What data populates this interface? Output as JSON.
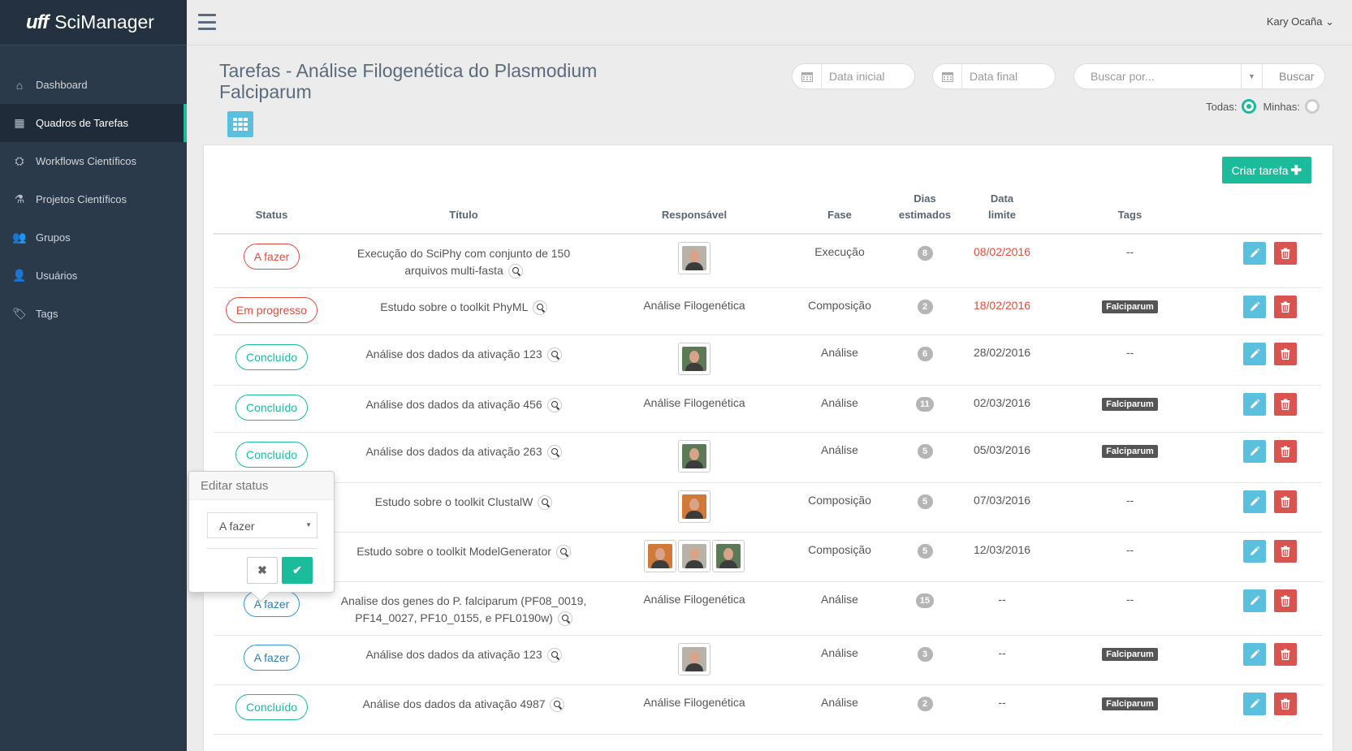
{
  "app": {
    "logo": "uff",
    "name": "SciManager"
  },
  "user": {
    "name": "Kary Ocaña ⌄"
  },
  "sidebar": {
    "items": [
      {
        "label": "Dashboard",
        "icon": "home-icon",
        "glyph": "⌂"
      },
      {
        "label": "Quadros de Tarefas",
        "icon": "grid-icon",
        "glyph": "▦"
      },
      {
        "label": "Workflows Científicos",
        "icon": "sitemap-icon",
        "glyph": "⛭"
      },
      {
        "label": "Projetos Científicos",
        "icon": "flask-icon",
        "glyph": "⚗"
      },
      {
        "label": "Grupos",
        "icon": "users-icon",
        "glyph": "👥"
      },
      {
        "label": "Usuários",
        "icon": "user-icon",
        "glyph": "👤"
      },
      {
        "label": "Tags",
        "icon": "tags-icon",
        "glyph": "🏷"
      }
    ],
    "active_index": 1
  },
  "header": {
    "title": "Tarefas - Análise Filogenética do Plasmodium Falciparum",
    "date_start_placeholder": "Data inicial",
    "date_end_placeholder": "Data final",
    "search_placeholder": "Buscar por...",
    "search_button": "Buscar",
    "filter_all": "Todas:",
    "filter_mine": "Minhas:"
  },
  "panel": {
    "create_button": "Criar tarefa"
  },
  "table": {
    "headers": {
      "status": "Status",
      "title": "Título",
      "responsible": "Responsável",
      "phase": "Fase",
      "days_1": "Dias",
      "days_2": "estimados",
      "deadline_1": "Data",
      "deadline_2": "limite",
      "tags": "Tags"
    },
    "rows": [
      {
        "status": "A fazer",
        "status_style": "afazer",
        "title": "Execução do SciPhy com conjunto de 150 arquivos multi-fasta",
        "resp_text": "",
        "avatars": [
          "f1"
        ],
        "phase": "Execução",
        "days": "8",
        "deadline": "08/02/2016",
        "deadline_overdue": true,
        "tag": "",
        "no_tag": "--"
      },
      {
        "status": "Em progresso",
        "status_style": "prog",
        "title": "Estudo sobre o toolkit PhyML",
        "resp_text": "Análise Filogenética",
        "avatars": [],
        "phase": "Composição",
        "days": "2",
        "deadline": "18/02/2016",
        "deadline_overdue": true,
        "tag": "Falciparum",
        "no_tag": ""
      },
      {
        "status": "Concluído",
        "status_style": "conc",
        "title": "Análise dos dados da ativação 123",
        "resp_text": "",
        "avatars": [
          "f2"
        ],
        "phase": "Análise",
        "days": "6",
        "deadline": "28/02/2016",
        "deadline_overdue": false,
        "tag": "",
        "no_tag": "--"
      },
      {
        "status": "Concluído",
        "status_style": "conc",
        "title": "Análise dos dados da ativação 456",
        "resp_text": "Análise Filogenética",
        "avatars": [],
        "phase": "Análise",
        "days": "11",
        "deadline": "02/03/2016",
        "deadline_overdue": false,
        "tag": "Falciparum",
        "no_tag": ""
      },
      {
        "status": "Concluído",
        "status_style": "conc",
        "title": "Análise dos dados da ativação 263",
        "resp_text": "",
        "avatars": [
          "f2"
        ],
        "phase": "Análise",
        "days": "5",
        "deadline": "05/03/2016",
        "deadline_overdue": false,
        "tag": "Falciparum",
        "no_tag": ""
      },
      {
        "status": "",
        "status_style": "hidden",
        "title": "Estudo sobre o toolkit ClustalW",
        "resp_text": "",
        "avatars": [
          "f3"
        ],
        "phase": "Composição",
        "days": "5",
        "deadline": "07/03/2016",
        "deadline_overdue": false,
        "tag": "",
        "no_tag": "--"
      },
      {
        "status": "",
        "status_style": "hidden",
        "title": "Estudo sobre o toolkit ModelGenerator",
        "resp_text": "",
        "avatars": [
          "f3",
          "f1",
          "f2"
        ],
        "phase": "Composição",
        "days": "5",
        "deadline": "12/03/2016",
        "deadline_overdue": false,
        "tag": "",
        "no_tag": "--"
      },
      {
        "status": "A fazer",
        "status_style": "afazer-blue",
        "title": "Analise dos genes do P. falciparum (PF08_0019, PF14_0027, PF10_0155, e PFL0190w)",
        "resp_text": "Análise Filogenética",
        "avatars": [],
        "phase": "Análise",
        "days": "15",
        "deadline": "--",
        "deadline_overdue": false,
        "tag": "",
        "no_tag": "--"
      },
      {
        "status": "A fazer",
        "status_style": "afazer-blue",
        "title": "Análise dos dados da ativação 123",
        "resp_text": "",
        "avatars": [
          "f1"
        ],
        "phase": "Análise",
        "days": "3",
        "deadline": "--",
        "deadline_overdue": false,
        "tag": "Falciparum",
        "no_tag": ""
      },
      {
        "status": "Concluído",
        "status_style": "conc",
        "title": "Análise dos dados da ativação 4987",
        "resp_text": "Análise Filogenética",
        "avatars": [],
        "phase": "Análise",
        "days": "2",
        "deadline": "--",
        "deadline_overdue": false,
        "tag": "Falciparum",
        "no_tag": ""
      }
    ]
  },
  "popover": {
    "title": "Editar status",
    "selected": "A fazer",
    "cancel_glyph": "✖",
    "ok_glyph": "✔"
  },
  "colors": {
    "accent": "#1abc9c",
    "danger": "#d9534f",
    "info": "#5bc0de",
    "sidebar": "#2b3a4a"
  }
}
